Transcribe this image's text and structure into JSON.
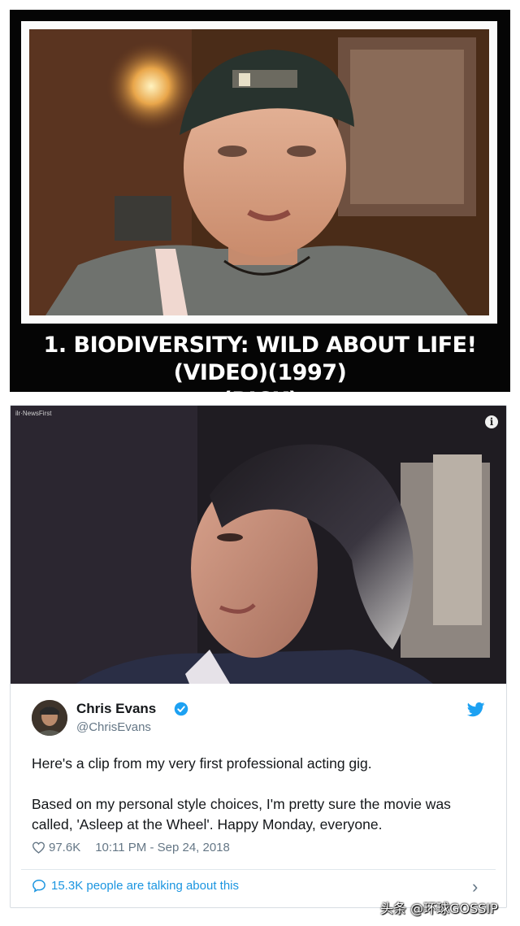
{
  "meme": {
    "caption_line1": "1. BIODIVERSITY: WILD ABOUT LIFE! (VIDEO)(1997)",
    "caption_line2": "(RICK)"
  },
  "tweet": {
    "video_source": "ilr·NewsFirst",
    "info_icon": "i",
    "author": {
      "name": "Chris Evans",
      "handle": "@ChrisEvans",
      "verified": true
    },
    "text": [
      "Here's a clip from my very first professional acting gig.",
      "Based on my personal style choices, I'm pretty sure the movie was called, 'Asleep at the Wheel'. Happy Monday, everyone."
    ],
    "likes": "97.6K",
    "timestamp": "10:11 PM - Sep 24, 2018",
    "conversation": "15.3K people are talking about this",
    "icons": {
      "verified": "verified-badge-icon",
      "bird": "twitter-bird-icon",
      "like": "heart-icon",
      "reply": "speech-bubble-icon",
      "more": "chevron-right-icon"
    },
    "colors": {
      "link_blue": "#1b95e0",
      "twitter_blue": "#1da1f2",
      "muted": "#657786",
      "text": "#14171a"
    }
  },
  "watermark": "头条 @环球GOSSIP"
}
